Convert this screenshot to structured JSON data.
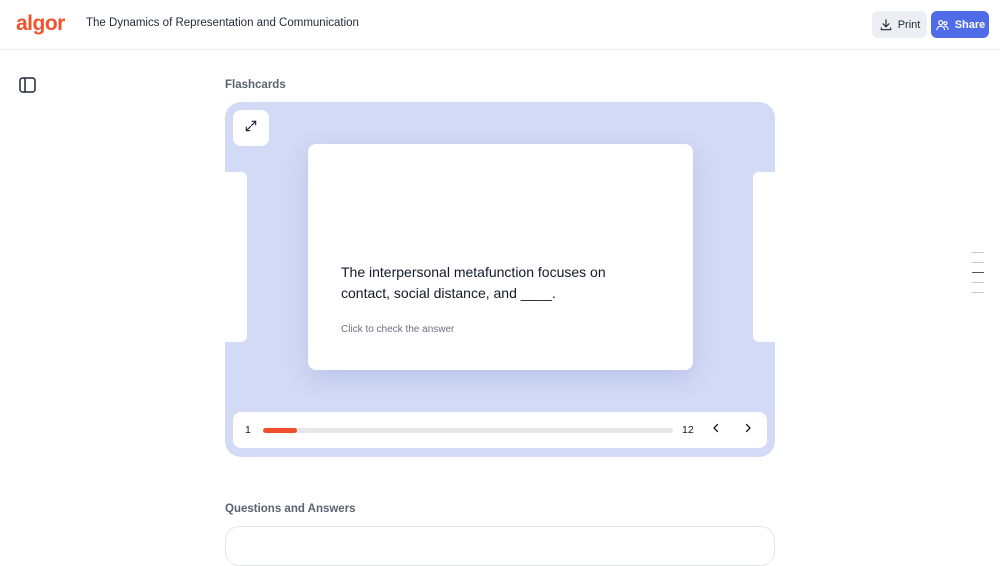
{
  "header": {
    "logo": "algor",
    "title": "The Dynamics of Representation and Communication",
    "print_label": "Print",
    "share_label": "Share"
  },
  "flashcards": {
    "section_title": "Flashcards",
    "question": "The interpersonal metafunction focuses on contact, social distance, and ____.",
    "hint": "Click to check the answer",
    "current": "1",
    "total": "12",
    "progress_fraction": 0.083
  },
  "qa": {
    "section_title": "Questions and Answers"
  },
  "colors": {
    "brand": "#f0532d",
    "accent": "#4f6be8",
    "stage_bg": "#d3daf5",
    "progress_fill": "#ee4e2a"
  },
  "icons": {
    "sidebar_toggle": "sidebar-panel-icon",
    "print": "download-icon",
    "share": "users-icon",
    "expand": "expand-arrows-icon",
    "prev": "chevron-left-icon",
    "next": "chevron-right-icon"
  },
  "rail": {
    "count": 5,
    "active_index": 2
  }
}
